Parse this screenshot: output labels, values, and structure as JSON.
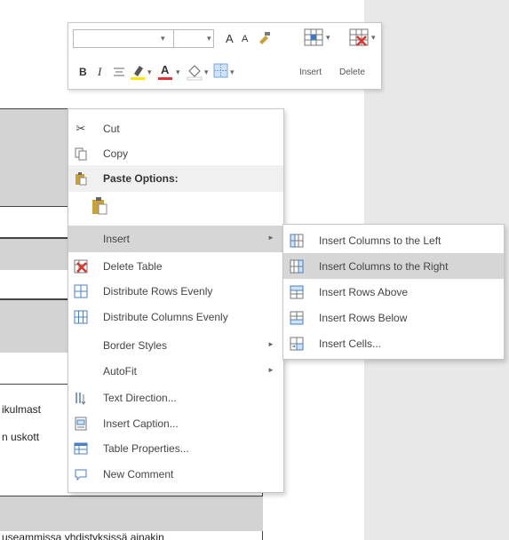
{
  "document": {
    "lines": [
      "ikulmast",
      "n uskott",
      "useammissa yhdistyksissä ainakin"
    ]
  },
  "mini_toolbar": {
    "font_name_value": "",
    "font_size_value": "",
    "grow_font": "A",
    "shrink_font": "A",
    "bold": "B",
    "italic": "I",
    "font_color_letter": "A",
    "insert_label": "Insert",
    "delete_label": "Delete"
  },
  "context_menu": {
    "items": [
      {
        "label": "Cut",
        "icon": "scissors-icon"
      },
      {
        "label": "Copy",
        "icon": "copy-icon"
      },
      {
        "label": "Paste Options:",
        "icon": "paste-icon"
      },
      {
        "label": "",
        "icon": "paste-keep-source-icon"
      },
      {
        "label": "Insert",
        "icon": ""
      },
      {
        "label": "Delete Table",
        "icon": "delete-table-icon"
      },
      {
        "label": "Distribute Rows Evenly",
        "icon": "distribute-rows-icon"
      },
      {
        "label": "Distribute Columns Evenly",
        "icon": "distribute-columns-icon"
      },
      {
        "label": "Border Styles",
        "icon": ""
      },
      {
        "label": "AutoFit",
        "icon": ""
      },
      {
        "label": "Text Direction...",
        "icon": "text-direction-icon"
      },
      {
        "label": "Insert Caption...",
        "icon": "insert-caption-icon"
      },
      {
        "label": "Table Properties...",
        "icon": "table-properties-icon"
      },
      {
        "label": "New Comment",
        "icon": "new-comment-icon"
      }
    ]
  },
  "submenu": {
    "items": [
      {
        "label": "Insert Columns to the Left",
        "icon": "insert-columns-left-icon"
      },
      {
        "label": "Insert Columns to the Right",
        "icon": "insert-columns-right-icon"
      },
      {
        "label": "Insert Rows Above",
        "icon": "insert-rows-above-icon"
      },
      {
        "label": "Insert Rows Below",
        "icon": "insert-rows-below-icon"
      },
      {
        "label": "Insert Cells...",
        "icon": "insert-cells-icon"
      }
    ]
  },
  "colors": {
    "highlight": "#d6d6d6",
    "highlighter_yellow": "#ffe600",
    "font_color_red": "#e03030",
    "delete_red": "#d9342b",
    "table_shading": "#d3d3d3"
  }
}
